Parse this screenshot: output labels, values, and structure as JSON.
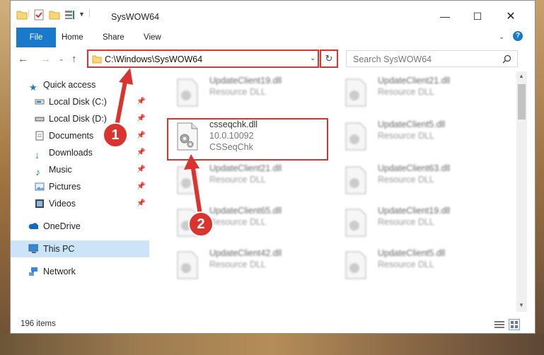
{
  "window": {
    "title": "SysWOW64"
  },
  "ribbon": {
    "tabs": [
      "File",
      "Home",
      "Share",
      "View"
    ]
  },
  "address": {
    "path": "C:\\Windows\\SysWOW64"
  },
  "search": {
    "placeholder": "Search SysWOW64"
  },
  "nav": {
    "items": [
      {
        "label": "Quick access",
        "icon": "star-icon",
        "pinned": false
      },
      {
        "label": "Local Disk (C:)",
        "icon": "drive-icon",
        "pinned": true
      },
      {
        "label": "Local Disk (D:)",
        "icon": "drive-icon",
        "pinned": true
      },
      {
        "label": "Documents",
        "icon": "document-icon",
        "pinned": true
      },
      {
        "label": "Downloads",
        "icon": "download-icon",
        "pinned": true
      },
      {
        "label": "Music",
        "icon": "music-icon",
        "pinned": true
      },
      {
        "label": "Pictures",
        "icon": "picture-icon",
        "pinned": true
      },
      {
        "label": "Videos",
        "icon": "video-icon",
        "pinned": true
      },
      {
        "label": "OneDrive",
        "icon": "cloud-icon",
        "pinned": false
      },
      {
        "label": "This PC",
        "icon": "computer-icon",
        "pinned": false,
        "selected": true
      },
      {
        "label": "Network",
        "icon": "network-icon",
        "pinned": false
      }
    ]
  },
  "files": {
    "left": [
      {
        "name": "UpdateClient19.dll",
        "type": "Resource DLL"
      },
      {
        "name": "csseqchk.dll",
        "version": "10.0.10092",
        "desc": "CSSeqChk"
      },
      {
        "name": "UpdateClient21.dll",
        "type": "Resource DLL"
      },
      {
        "name": "UpdateClient65.dll",
        "type": "Resource DLL"
      },
      {
        "name": "UpdateClient42.dll",
        "type": "Resource DLL"
      }
    ],
    "right": [
      {
        "name": "UpdateClient21.dll",
        "type": "Resource DLL"
      },
      {
        "name": "UpdateClient5.dll",
        "type": "Resource DLL"
      },
      {
        "name": "UpdateClient63.dll",
        "type": "Resource DLL"
      },
      {
        "name": "UpdateClient19.dll",
        "type": "Resource DLL"
      },
      {
        "name": "UpdateClient5.dll",
        "type": "Resource DLL"
      }
    ]
  },
  "status": {
    "count": "196 items"
  },
  "callouts": {
    "one": "1",
    "two": "2"
  },
  "colors": {
    "accent": "#1979ca",
    "highlight": "#d9342d",
    "selected": "#cce4f7"
  }
}
